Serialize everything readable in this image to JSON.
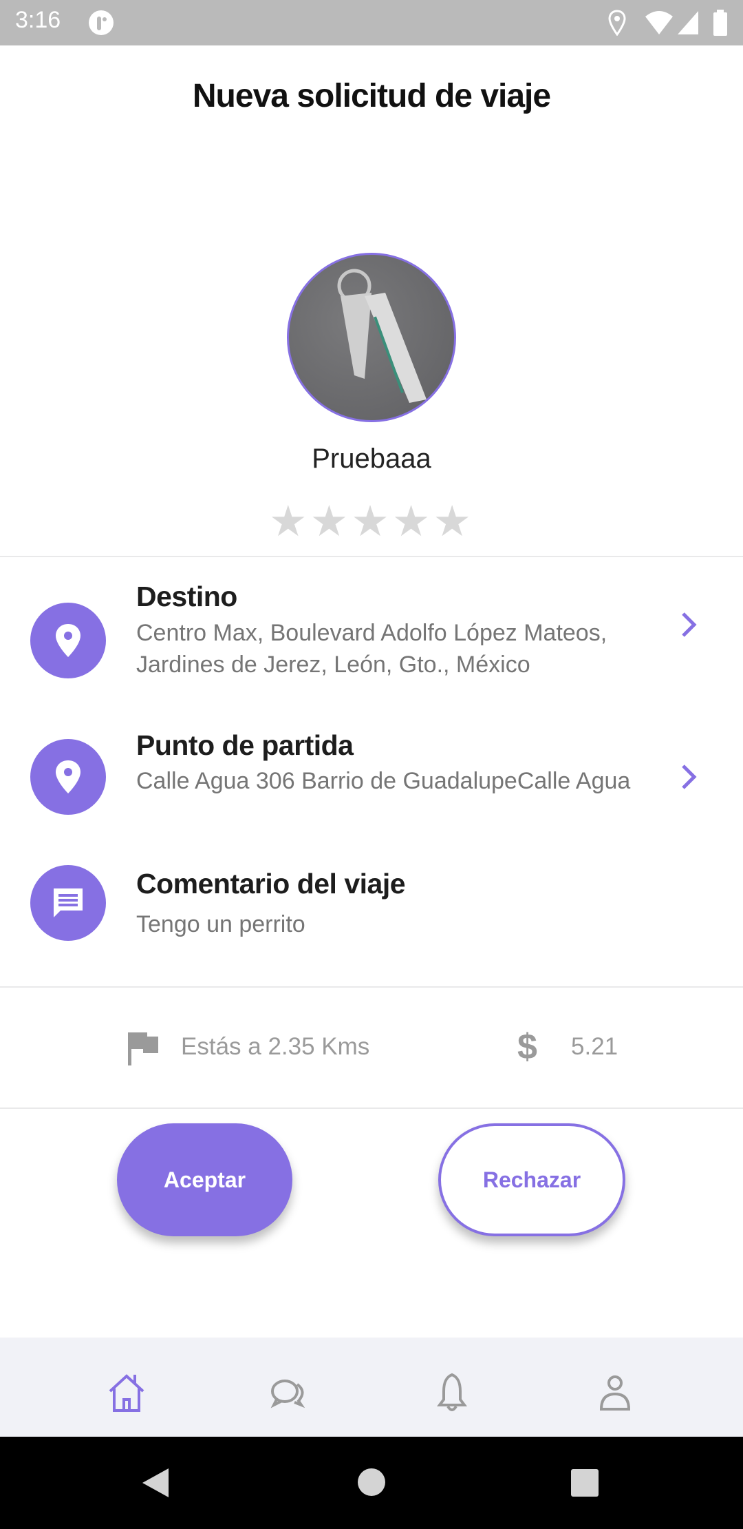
{
  "status_bar": {
    "time": "3:16"
  },
  "header": {
    "title": "Nueva solicitud de viaje"
  },
  "profile": {
    "name": "Pruebaaa",
    "rating": 0,
    "max_rating": 5
  },
  "details": [
    {
      "title": "Destino",
      "text": "Centro Max, Boulevard Adolfo López Mateos, Jardines de Jerez, León, Gto., México",
      "icon": "location-pin-icon"
    },
    {
      "title": "Punto de partida",
      "text": "Calle Agua 306 Barrio de GuadalupeCalle Agua",
      "icon": "location-pin-icon"
    },
    {
      "title": "Comentario del viaje",
      "text": "Tengo un perrito",
      "icon": "comment-icon"
    }
  ],
  "trip": {
    "distance": "Estás a 2.35 Kms",
    "price": "5.21"
  },
  "actions": {
    "accept": "Aceptar",
    "reject": "Rechazar"
  },
  "colors": {
    "accent": "#8670e3",
    "muted": "#9a9a9a"
  }
}
